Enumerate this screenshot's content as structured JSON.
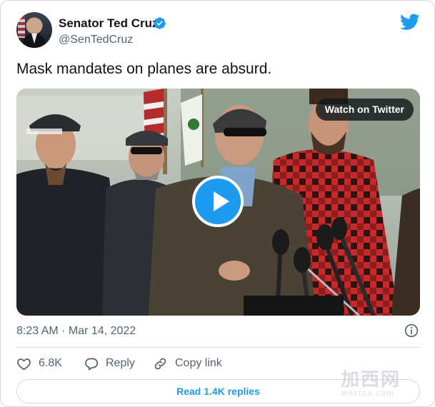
{
  "author": {
    "name": "Senator Ted Cruz",
    "handle": "@SenTedCruz",
    "verified": true
  },
  "tweet": {
    "text": "Mask mandates on planes are absurd.",
    "timestamp": "8:23 AM · Mar 14, 2022"
  },
  "media": {
    "watch_label": "Watch on Twitter"
  },
  "actions": {
    "like_count": "6.8K",
    "reply_label": "Reply",
    "copy_link_label": "Copy link"
  },
  "read_replies_label": "Read 1.4K replies",
  "watermark": {
    "cn": "加西网",
    "url": "westca.com"
  },
  "colors": {
    "brand_blue": "#1d9bf0",
    "text_primary": "#0f1419",
    "text_secondary": "#536471",
    "border": "#cfd9de"
  },
  "icons": [
    "verified-badge-icon",
    "twitter-bird-icon",
    "play-icon",
    "info-icon",
    "heart-icon",
    "reply-icon",
    "link-icon"
  ]
}
